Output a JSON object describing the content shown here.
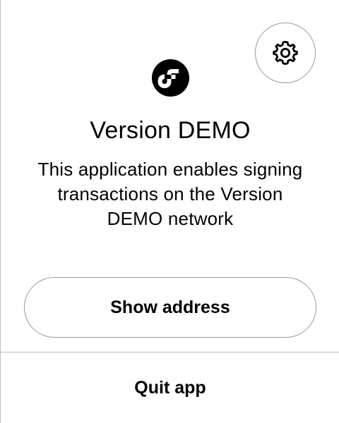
{
  "app": {
    "title": "Version DEMO",
    "description": "This application enables signing transactions on the Version DEMO network",
    "logo_icon": "flow-logo-icon"
  },
  "actions": {
    "settings_icon": "gear-icon",
    "show_address_label": "Show address",
    "quit_label": "Quit app"
  },
  "colors": {
    "text": "#000000",
    "background": "#ffffff",
    "border": "#9a9a9a",
    "divider": "#bdbdbd",
    "logo_fill": "#000000"
  }
}
